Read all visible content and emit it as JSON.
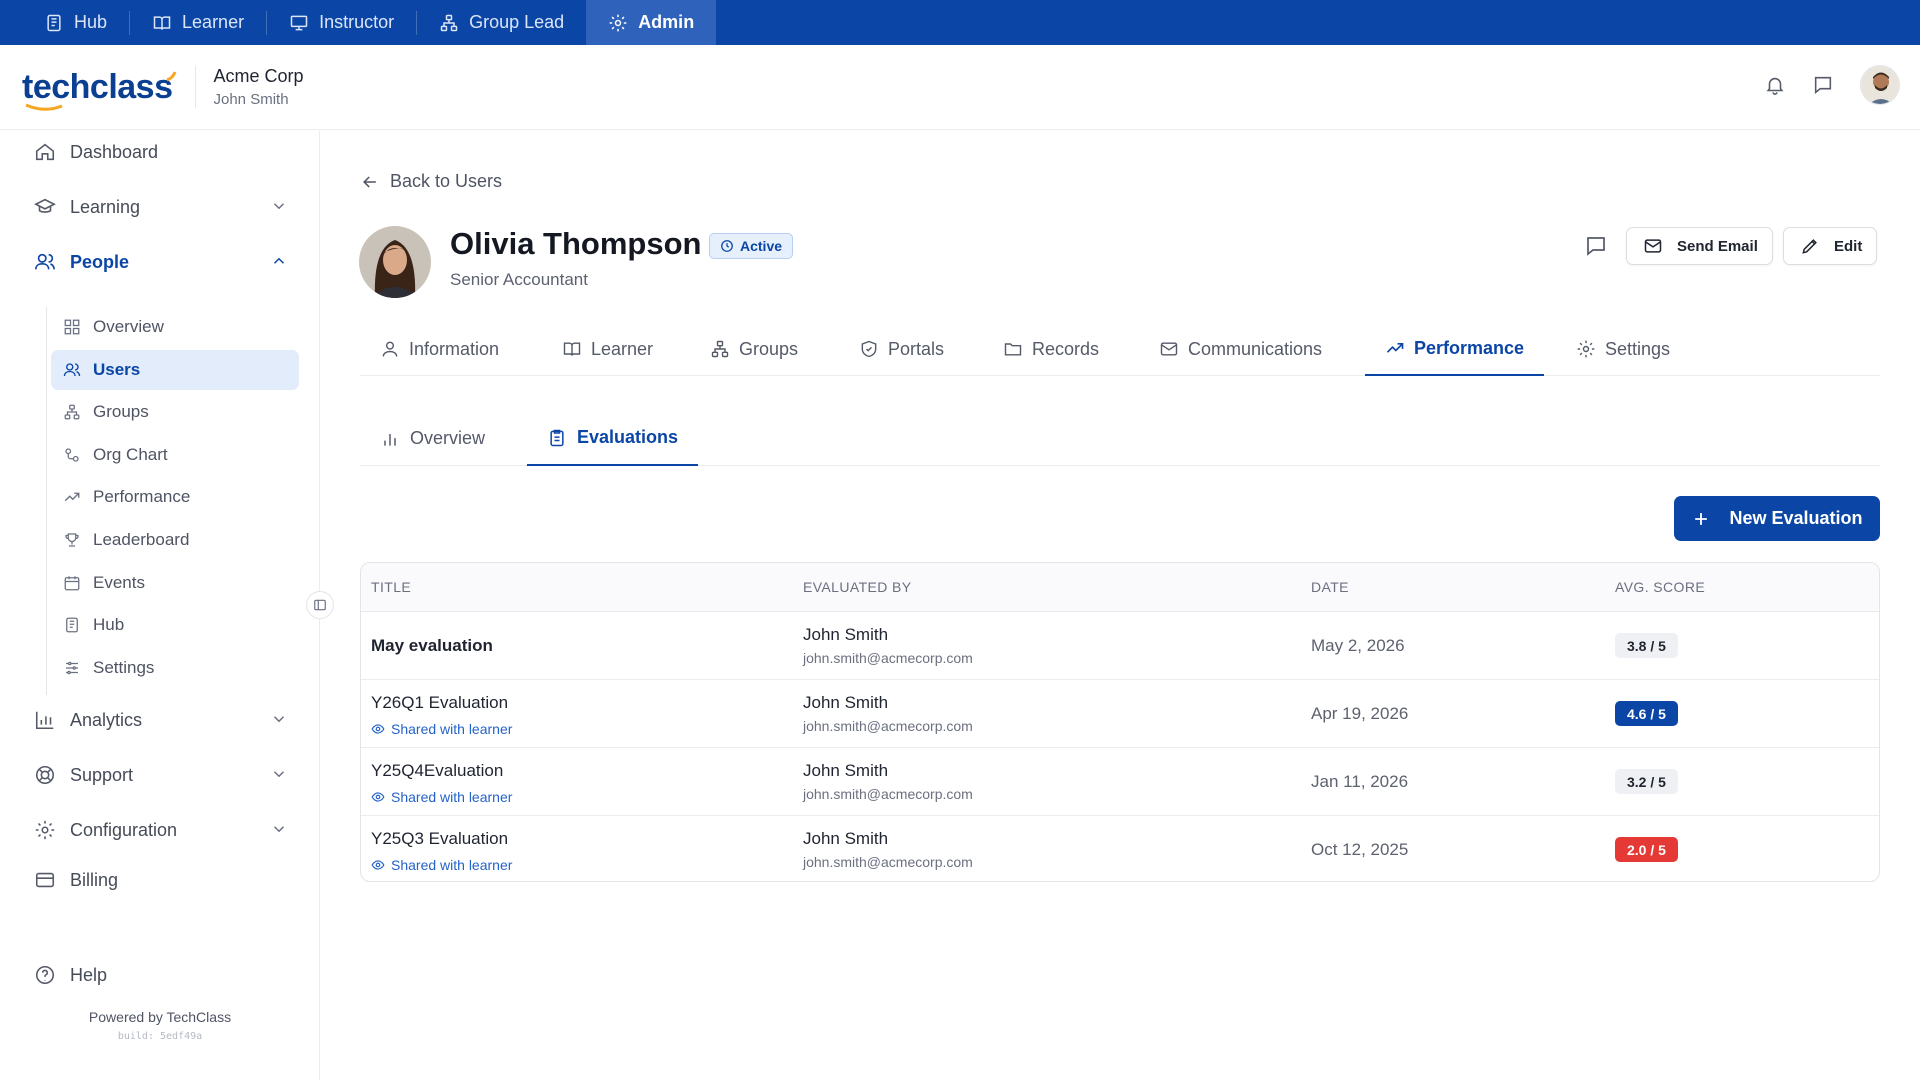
{
  "roles": [
    {
      "label": "Hub",
      "icon": "hub-icon",
      "active": false
    },
    {
      "label": "Learner",
      "icon": "book-icon",
      "active": false
    },
    {
      "label": "Instructor",
      "icon": "presentation-icon",
      "active": false
    },
    {
      "label": "Group Lead",
      "icon": "group-icon",
      "active": false
    },
    {
      "label": "Admin",
      "icon": "gear-icon",
      "active": true
    }
  ],
  "header": {
    "logo": "techclass",
    "org_name": "Acme Corp",
    "user_name": "John Smith"
  },
  "sidebar": {
    "items": [
      {
        "label": "Dashboard"
      },
      {
        "label": "Learning"
      },
      {
        "label": "People"
      },
      {
        "label": "Analytics"
      },
      {
        "label": "Support"
      },
      {
        "label": "Configuration"
      },
      {
        "label": "Billing"
      },
      {
        "label": "Help"
      }
    ],
    "people_sub": [
      {
        "label": "Overview"
      },
      {
        "label": "Users"
      },
      {
        "label": "Groups"
      },
      {
        "label": "Org Chart"
      },
      {
        "label": "Performance"
      },
      {
        "label": "Leaderboard"
      },
      {
        "label": "Events"
      },
      {
        "label": "Hub"
      },
      {
        "label": "Settings"
      }
    ],
    "powered_by": "Powered by TechClass",
    "build": "build: 5edf49a"
  },
  "main": {
    "back_label": "Back to Users",
    "profile": {
      "name": "Olivia Thompson",
      "status": "Active",
      "title": "Senior Accountant"
    },
    "buttons": {
      "send_email": "Send Email",
      "edit": "Edit",
      "new_evaluation": "New Evaluation"
    },
    "tabs": [
      {
        "label": "Information"
      },
      {
        "label": "Learner"
      },
      {
        "label": "Groups"
      },
      {
        "label": "Portals"
      },
      {
        "label": "Records"
      },
      {
        "label": "Communications"
      },
      {
        "label": "Performance"
      },
      {
        "label": "Settings"
      }
    ],
    "active_tab": "Performance",
    "subtabs": [
      {
        "label": "Overview"
      },
      {
        "label": "Evaluations"
      }
    ],
    "active_subtab": "Evaluations",
    "table": {
      "columns": [
        "TITLE",
        "EVALUATED BY",
        "DATE",
        "AVG. SCORE"
      ],
      "shared_label": "Shared with learner",
      "rows": [
        {
          "title": "May evaluation",
          "shared": false,
          "evaluator": "John Smith",
          "email": "john.smith@acmecorp.com",
          "date": "May 2, 2026",
          "score": "3.8 / 5",
          "score_bg": "#eef0f3",
          "score_color": "#1f2430"
        },
        {
          "title": "Y26Q1 Evaluation",
          "shared": true,
          "evaluator": "John Smith",
          "email": "john.smith@acmecorp.com",
          "date": "Apr 19, 2026",
          "score": "4.6 / 5",
          "score_bg": "#0b46a6",
          "score_color": "#ffffff"
        },
        {
          "title": "Y25Q4Evaluation",
          "shared": true,
          "evaluator": "John Smith",
          "email": "john.smith@acmecorp.com",
          "date": "Jan 11, 2026",
          "score": "3.2 / 5",
          "score_bg": "#eef0f3",
          "score_color": "#1f2430"
        },
        {
          "title": "Y25Q3 Evaluation",
          "shared": true,
          "evaluator": "John Smith",
          "email": "john.smith@acmecorp.com",
          "date": "Oct 12, 2025",
          "score": "2.0 / 5",
          "score_bg": "#e53935",
          "score_color": "#ffffff"
        }
      ]
    }
  },
  "colors": {
    "brand": "#0b46a6",
    "active_bg": "#e2ecfb",
    "danger": "#e53935"
  }
}
